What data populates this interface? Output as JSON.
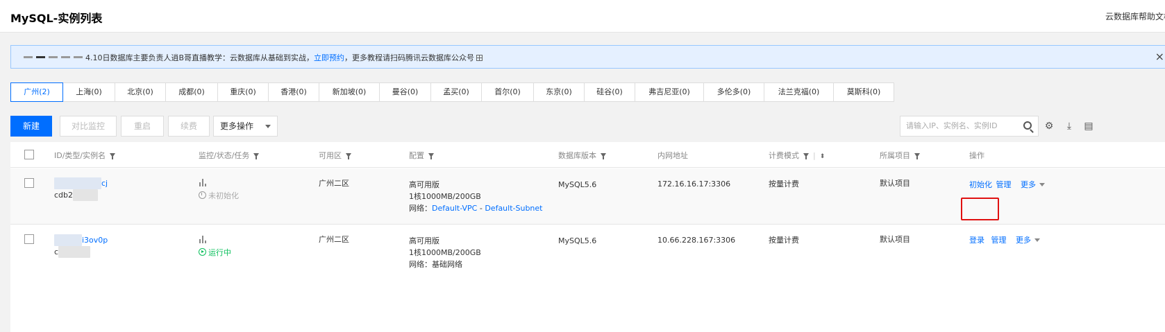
{
  "header": {
    "title": "MySQL-实例列表",
    "help_link": "云数据库帮助文档"
  },
  "notice": {
    "text_before": "4.10日数据库主要负责人逍B哥直播教学：云数据库从基础到实战，",
    "link_text": "立即预约",
    "text_after": "，更多教程请扫码腾讯云数据库公众号",
    "close": "×"
  },
  "regions": [
    {
      "label": "广州(2)",
      "active": true
    },
    {
      "label": "上海(0)"
    },
    {
      "label": "北京(0)"
    },
    {
      "label": "成都(0)"
    },
    {
      "label": "重庆(0)"
    },
    {
      "label": "香港(0)"
    },
    {
      "label": "新加坡(0)"
    },
    {
      "label": "曼谷(0)"
    },
    {
      "label": "孟买(0)"
    },
    {
      "label": "首尔(0)"
    },
    {
      "label": "东京(0)"
    },
    {
      "label": "硅谷(0)"
    },
    {
      "label": "弗吉尼亚(0)"
    },
    {
      "label": "多伦多(0)"
    },
    {
      "label": "法兰克福(0)"
    },
    {
      "label": "莫斯科(0)"
    }
  ],
  "toolbar": {
    "new_label": "新建",
    "compare_label": "对比监控",
    "restart_label": "重启",
    "renew_label": "续费",
    "more_ops_label": "更多操作",
    "search_placeholder": "请输入IP、实例名、实例ID"
  },
  "columns": {
    "id": "ID/类型/实例名",
    "monitor": "监控/状态/任务",
    "zone": "可用区",
    "config": "配置",
    "version": "数据库版本",
    "ip": "内网地址",
    "billing": "计费模式",
    "project": "所属项目",
    "ops": "操作"
  },
  "rows": [
    {
      "id_suffix": "cj",
      "name_prefix": "cdb2",
      "status": "未初始化",
      "zone": "广州二区",
      "config_type": "高可用版",
      "config_spec": "1核1000MB/200GB",
      "network_label": "网络：",
      "vpc": "Default-VPC",
      "subnet_sep": " - ",
      "subnet": "Default-Subnet",
      "version": "MySQL5.6",
      "ip": "172.16.16.17:3306",
      "billing": "按量计费",
      "project": "默认项目",
      "op1": "初始化",
      "op2": "管理",
      "op3": "更多"
    },
    {
      "id_suffix": "i3ov0p",
      "name_prefix": "c",
      "status": "运行中",
      "zone": "广州二区",
      "config_type": "高可用版",
      "config_spec": "1核1000MB/200GB",
      "network": "网络：基础网络",
      "version": "MySQL5.6",
      "ip": "10.66.228.167:3306",
      "billing": "按量计费",
      "project": "默认项目",
      "op1": "登录",
      "op2": "管理",
      "op3": "更多"
    }
  ],
  "colors": {
    "accent": "#006eff",
    "running": "#0abf5b",
    "highlight": "#e01010"
  }
}
